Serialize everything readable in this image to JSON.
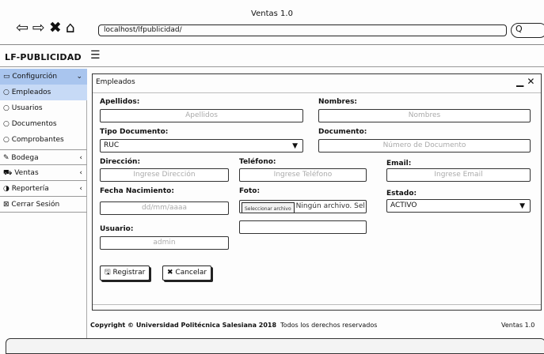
{
  "window": {
    "title": "Ventas 1.0"
  },
  "browser": {
    "url": "localhost/lfpublicidad/",
    "search_glyph": "Q"
  },
  "brand": {
    "prefix": "LF",
    "name": "-PUBLICIDAD"
  },
  "sidebar": {
    "items": [
      {
        "label": "Configurción",
        "icon": "monitor-icon",
        "chev": "⌄",
        "active": true
      },
      {
        "label": "Empleados",
        "icon": "circle-icon",
        "selected": true
      },
      {
        "label": "Usuarios",
        "icon": "circle-icon"
      },
      {
        "label": "Documentos",
        "icon": "circle-icon"
      },
      {
        "label": "Comprobantes",
        "icon": "circle-icon"
      },
      {
        "label": "Bodega",
        "icon": "edit-icon",
        "chev": "‹"
      },
      {
        "label": "Ventas",
        "icon": "cart-icon",
        "chev": "‹"
      },
      {
        "label": "Reportería",
        "icon": "pie-chart-icon",
        "chev": "‹"
      },
      {
        "label": "Cerrar Sesión",
        "icon": "close-box-icon"
      }
    ]
  },
  "panel": {
    "title": "Empleados",
    "minimize": "▁",
    "close": "✕"
  },
  "form": {
    "apellidos": {
      "label": "Apellidos:",
      "placeholder": "Apellidos"
    },
    "nombres": {
      "label": "Nombres:",
      "placeholder": "Nombres"
    },
    "tipo_documento": {
      "label": "Tipo Documento:",
      "value": "RUC"
    },
    "documento": {
      "label": "Documento:",
      "placeholder": "Número de Documento"
    },
    "direccion": {
      "label": "Dirección:",
      "placeholder": "Ingrese Dirección"
    },
    "telefono": {
      "label": "Teléfono:",
      "placeholder": "Ingrese Teléfono"
    },
    "email": {
      "label": "Email:",
      "placeholder": "Ingrese Email"
    },
    "fecha_nacimiento": {
      "label": "Fecha Nacimiento:",
      "placeholder": "dd/mm/aaaa"
    },
    "foto": {
      "label": "Foto:",
      "button": "Seleccionar archivo",
      "status": "Ningún archivo. Sel"
    },
    "estado": {
      "label": "Estado:",
      "value": "ACTIVO"
    },
    "usuario": {
      "label": "Usuario:",
      "value": "admin"
    },
    "registrar": "Registrar",
    "cancelar": "Cancelar"
  },
  "footer": {
    "copyright": "Copyright © Universidad Politécnica Salesiana 2018",
    "rights": "Todos los derechos reservados",
    "version": "Ventas 1.0"
  },
  "colors": {
    "active_bg": "#a9c5ee",
    "selected_bg": "#c7daf6"
  }
}
